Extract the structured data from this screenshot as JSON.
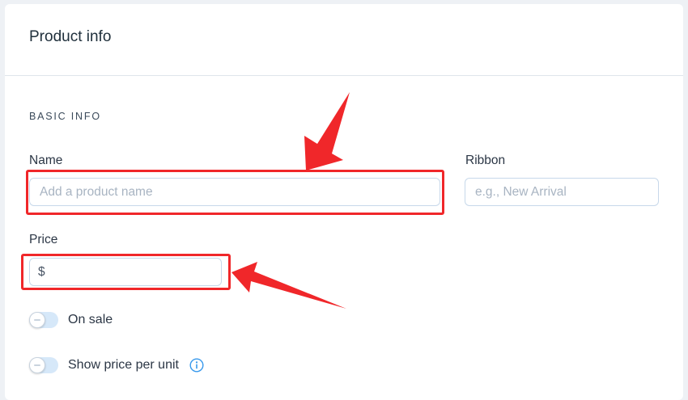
{
  "card": {
    "title": "Product info"
  },
  "basic_info": {
    "section_label": "BASIC INFO",
    "name": {
      "label": "Name",
      "value": "",
      "placeholder": "Add a product name"
    },
    "ribbon": {
      "label": "Ribbon",
      "value": "",
      "placeholder": "e.g., New Arrival"
    },
    "price": {
      "label": "Price",
      "currency_symbol": "$",
      "value": ""
    },
    "on_sale": {
      "label": "On sale",
      "enabled": false
    },
    "price_per_unit": {
      "label": "Show price per unit",
      "enabled": false,
      "info_icon": "info-circle-icon"
    }
  },
  "annotations": {
    "highlight_color": "#f0272a",
    "arrow_color": "#f0272a"
  },
  "colors": {
    "accent": "#3899ec",
    "input_border": "#c7d8ea",
    "toggle_track": "#d6e8f9"
  }
}
